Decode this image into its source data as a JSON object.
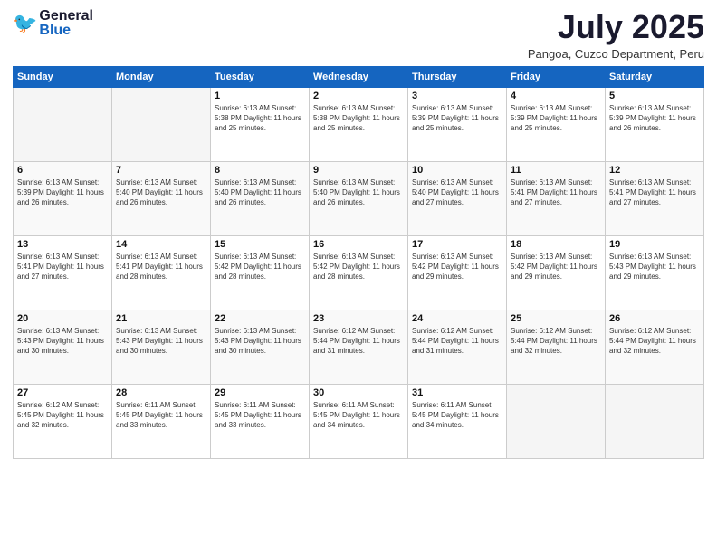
{
  "header": {
    "logo_general": "General",
    "logo_blue": "Blue",
    "month": "July 2025",
    "location": "Pangoa, Cuzco Department, Peru"
  },
  "weekdays": [
    "Sunday",
    "Monday",
    "Tuesday",
    "Wednesday",
    "Thursday",
    "Friday",
    "Saturday"
  ],
  "weeks": [
    [
      {
        "day": "",
        "info": ""
      },
      {
        "day": "",
        "info": ""
      },
      {
        "day": "1",
        "info": "Sunrise: 6:13 AM\nSunset: 5:38 PM\nDaylight: 11 hours and 25 minutes."
      },
      {
        "day": "2",
        "info": "Sunrise: 6:13 AM\nSunset: 5:38 PM\nDaylight: 11 hours and 25 minutes."
      },
      {
        "day": "3",
        "info": "Sunrise: 6:13 AM\nSunset: 5:39 PM\nDaylight: 11 hours and 25 minutes."
      },
      {
        "day": "4",
        "info": "Sunrise: 6:13 AM\nSunset: 5:39 PM\nDaylight: 11 hours and 25 minutes."
      },
      {
        "day": "5",
        "info": "Sunrise: 6:13 AM\nSunset: 5:39 PM\nDaylight: 11 hours and 26 minutes."
      }
    ],
    [
      {
        "day": "6",
        "info": "Sunrise: 6:13 AM\nSunset: 5:39 PM\nDaylight: 11 hours and 26 minutes."
      },
      {
        "day": "7",
        "info": "Sunrise: 6:13 AM\nSunset: 5:40 PM\nDaylight: 11 hours and 26 minutes."
      },
      {
        "day": "8",
        "info": "Sunrise: 6:13 AM\nSunset: 5:40 PM\nDaylight: 11 hours and 26 minutes."
      },
      {
        "day": "9",
        "info": "Sunrise: 6:13 AM\nSunset: 5:40 PM\nDaylight: 11 hours and 26 minutes."
      },
      {
        "day": "10",
        "info": "Sunrise: 6:13 AM\nSunset: 5:40 PM\nDaylight: 11 hours and 27 minutes."
      },
      {
        "day": "11",
        "info": "Sunrise: 6:13 AM\nSunset: 5:41 PM\nDaylight: 11 hours and 27 minutes."
      },
      {
        "day": "12",
        "info": "Sunrise: 6:13 AM\nSunset: 5:41 PM\nDaylight: 11 hours and 27 minutes."
      }
    ],
    [
      {
        "day": "13",
        "info": "Sunrise: 6:13 AM\nSunset: 5:41 PM\nDaylight: 11 hours and 27 minutes."
      },
      {
        "day": "14",
        "info": "Sunrise: 6:13 AM\nSunset: 5:41 PM\nDaylight: 11 hours and 28 minutes."
      },
      {
        "day": "15",
        "info": "Sunrise: 6:13 AM\nSunset: 5:42 PM\nDaylight: 11 hours and 28 minutes."
      },
      {
        "day": "16",
        "info": "Sunrise: 6:13 AM\nSunset: 5:42 PM\nDaylight: 11 hours and 28 minutes."
      },
      {
        "day": "17",
        "info": "Sunrise: 6:13 AM\nSunset: 5:42 PM\nDaylight: 11 hours and 29 minutes."
      },
      {
        "day": "18",
        "info": "Sunrise: 6:13 AM\nSunset: 5:42 PM\nDaylight: 11 hours and 29 minutes."
      },
      {
        "day": "19",
        "info": "Sunrise: 6:13 AM\nSunset: 5:43 PM\nDaylight: 11 hours and 29 minutes."
      }
    ],
    [
      {
        "day": "20",
        "info": "Sunrise: 6:13 AM\nSunset: 5:43 PM\nDaylight: 11 hours and 30 minutes."
      },
      {
        "day": "21",
        "info": "Sunrise: 6:13 AM\nSunset: 5:43 PM\nDaylight: 11 hours and 30 minutes."
      },
      {
        "day": "22",
        "info": "Sunrise: 6:13 AM\nSunset: 5:43 PM\nDaylight: 11 hours and 30 minutes."
      },
      {
        "day": "23",
        "info": "Sunrise: 6:12 AM\nSunset: 5:44 PM\nDaylight: 11 hours and 31 minutes."
      },
      {
        "day": "24",
        "info": "Sunrise: 6:12 AM\nSunset: 5:44 PM\nDaylight: 11 hours and 31 minutes."
      },
      {
        "day": "25",
        "info": "Sunrise: 6:12 AM\nSunset: 5:44 PM\nDaylight: 11 hours and 32 minutes."
      },
      {
        "day": "26",
        "info": "Sunrise: 6:12 AM\nSunset: 5:44 PM\nDaylight: 11 hours and 32 minutes."
      }
    ],
    [
      {
        "day": "27",
        "info": "Sunrise: 6:12 AM\nSunset: 5:45 PM\nDaylight: 11 hours and 32 minutes."
      },
      {
        "day": "28",
        "info": "Sunrise: 6:11 AM\nSunset: 5:45 PM\nDaylight: 11 hours and 33 minutes."
      },
      {
        "day": "29",
        "info": "Sunrise: 6:11 AM\nSunset: 5:45 PM\nDaylight: 11 hours and 33 minutes."
      },
      {
        "day": "30",
        "info": "Sunrise: 6:11 AM\nSunset: 5:45 PM\nDaylight: 11 hours and 34 minutes."
      },
      {
        "day": "31",
        "info": "Sunrise: 6:11 AM\nSunset: 5:45 PM\nDaylight: 11 hours and 34 minutes."
      },
      {
        "day": "",
        "info": ""
      },
      {
        "day": "",
        "info": ""
      }
    ]
  ]
}
